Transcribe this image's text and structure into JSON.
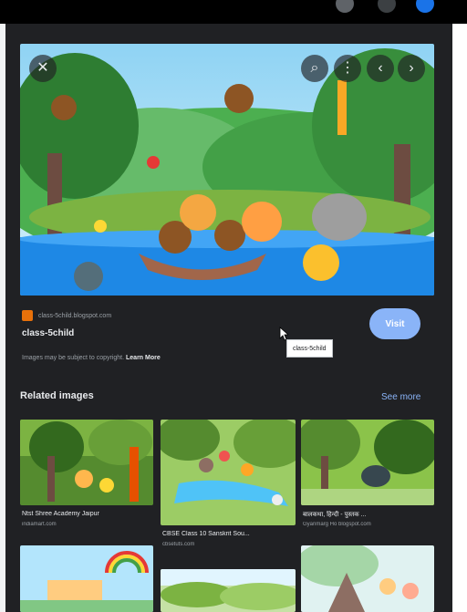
{
  "colors": {
    "panel_bg": "#202124",
    "accent": "#8ab4f8",
    "text_primary": "#e8eaed",
    "text_secondary": "#9aa0a6",
    "favicon": "#e8710a"
  },
  "toolbar": {
    "icons": [
      "settings-icon",
      "apps-icon",
      "account-avatar"
    ]
  },
  "viewer": {
    "controls": {
      "close_icon": "✕",
      "lens_icon": "⌕",
      "more_icon": "⋮",
      "prev_icon": "‹",
      "next_icon": "›"
    },
    "source_domain": "class-5child.blogspot.com",
    "title": "class-5child",
    "copyright_text": "Images may be subject to copyright.",
    "learn_more": "Learn More",
    "visit_label": "Visit",
    "tooltip": "class-5child"
  },
  "related": {
    "heading": "Related images",
    "see_more": "See more",
    "items": [
      {
        "title": "Ntst Shree Academy Jaipur",
        "source": "indiamart.com"
      },
      {
        "title": "CBSE Class 10 Sanskrit Sou...",
        "source": "cbsetuts.com"
      },
      {
        "title": "बालकथा, हिन्दी - पुस्तक ...",
        "source": "Gyanmarg Ho blogspot.com"
      },
      {
        "title": "",
        "source": ""
      },
      {
        "title": "",
        "source": ""
      },
      {
        "title": "",
        "source": ""
      }
    ]
  }
}
